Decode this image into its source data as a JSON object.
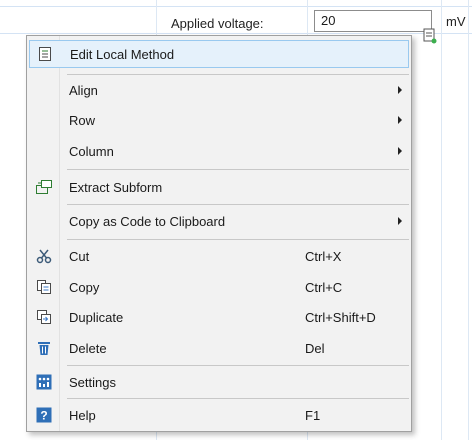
{
  "form": {
    "label": "Applied voltage:",
    "value": "20",
    "unit": "mV"
  },
  "menu": {
    "items": [
      {
        "label": "Edit Local Method",
        "icon": "edit-method-icon"
      },
      {
        "label": "Align",
        "submenu": true
      },
      {
        "label": "Row",
        "submenu": true
      },
      {
        "label": "Column",
        "submenu": true
      },
      {
        "label": "Extract Subform",
        "icon": "extract-subform-icon"
      },
      {
        "label": "Copy as Code to Clipboard",
        "submenu": true
      },
      {
        "label": "Cut",
        "shortcut": "Ctrl+X",
        "icon": "scissors-icon"
      },
      {
        "label": "Copy",
        "shortcut": "Ctrl+C",
        "icon": "copy-icon"
      },
      {
        "label": "Duplicate",
        "shortcut": "Ctrl+Shift+D",
        "icon": "duplicate-icon"
      },
      {
        "label": "Delete",
        "shortcut": "Del",
        "icon": "trash-icon"
      },
      {
        "label": "Settings",
        "icon": "settings-icon"
      },
      {
        "label": "Help",
        "shortcut": "F1",
        "icon": "help-icon"
      }
    ]
  }
}
